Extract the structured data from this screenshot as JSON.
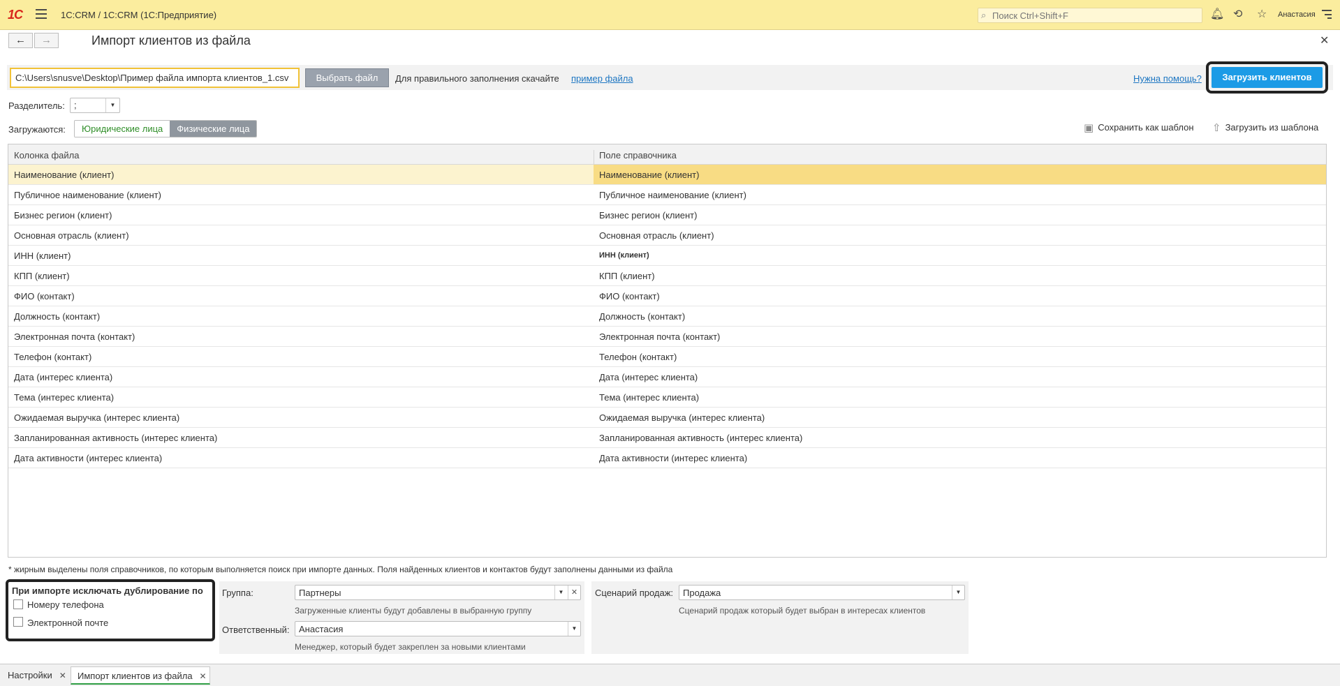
{
  "app": {
    "logo": "1С",
    "title": "1C:CRM / 1C:CRM  (1С:Предприятие)",
    "search_placeholder": "Поиск Ctrl+Shift+F",
    "user": "Анастасия"
  },
  "form": {
    "title": "Импорт клиентов из файла",
    "file_path": "C:\\Users\\snusve\\Desktop\\Пример файла импорта клиентов_1.csv",
    "choose_file": "Выбрать файл",
    "hint": "Для правильного заполнения скачайте",
    "example_link": "пример файла",
    "help_link": "Нужна помощь?",
    "load_button": "Загрузить клиентов",
    "separator_label": "Разделитель:",
    "separator_value": ";",
    "loaded_label": "Загружаются:",
    "seg_legal": "Юридические лица",
    "seg_individual": "Физические лица",
    "save_template": "Сохранить как шаблон",
    "load_template": "Загрузить из шаблона"
  },
  "table": {
    "col1": "Колонка файла",
    "col2": "Поле справочника",
    "rows": [
      {
        "c1": "Наименование (клиент)",
        "c2": "Наименование (клиент)"
      },
      {
        "c1": "Публичное наименование (клиент)",
        "c2": "Публичное наименование (клиент)"
      },
      {
        "c1": "Бизнес регион (клиент)",
        "c2": "Бизнес регион (клиент)"
      },
      {
        "c1": "Основная отрасль (клиент)",
        "c2": "Основная отрасль (клиент)"
      },
      {
        "c1": "ИНН (клиент)",
        "c2": "ИНН (клиент)"
      },
      {
        "c1": "КПП (клиент)",
        "c2": "КПП (клиент)"
      },
      {
        "c1": "ФИО (контакт)",
        "c2": "ФИО (контакт)"
      },
      {
        "c1": "Должность (контакт)",
        "c2": "Должность (контакт)"
      },
      {
        "c1": "Электронная почта (контакт)",
        "c2": "Электронная почта (контакт)"
      },
      {
        "c1": "Телефон (контакт)",
        "c2": "Телефон (контакт)"
      },
      {
        "c1": "Дата (интерес клиента)",
        "c2": "Дата (интерес клиента)"
      },
      {
        "c1": "Тема (интерес клиента)",
        "c2": "Тема (интерес клиента)"
      },
      {
        "c1": "Ожидаемая выручка (интерес клиента)",
        "c2": "Ожидаемая выручка (интерес клиента)"
      },
      {
        "c1": "Запланированная активность (интерес клиента)",
        "c2": "Запланированная активность (интерес клиента)"
      },
      {
        "c1": "Дата активности (интерес клиента)",
        "c2": "Дата активности (интерес клиента)"
      }
    ]
  },
  "footnote": "* жирным выделены поля справочников,  по которым выполняется поиск при импорте данных.  Поля найденных клиентов и контактов будут заполнены  данными из файла",
  "dedup": {
    "title": "При импорте исключать дублирование по",
    "phone": "Номеру телефона",
    "email": "Электронной  почте"
  },
  "group": {
    "label": "Группа:",
    "value": "Партнеры",
    "hint": "Загруженные клиенты будут добавлены в выбранную группу",
    "resp_label": "Ответственный:",
    "resp_value": "Анастасия",
    "resp_hint": "Менеджер, который будет закреплен за новыми клиентами"
  },
  "scenario": {
    "label": "Сценарий продаж:",
    "value": "Продажа",
    "hint": "Сценарий продаж который будет выбран  в  интересах клиентов"
  },
  "tabs": [
    {
      "label": "Настройки"
    },
    {
      "label": "Импорт клиентов из файла"
    }
  ]
}
